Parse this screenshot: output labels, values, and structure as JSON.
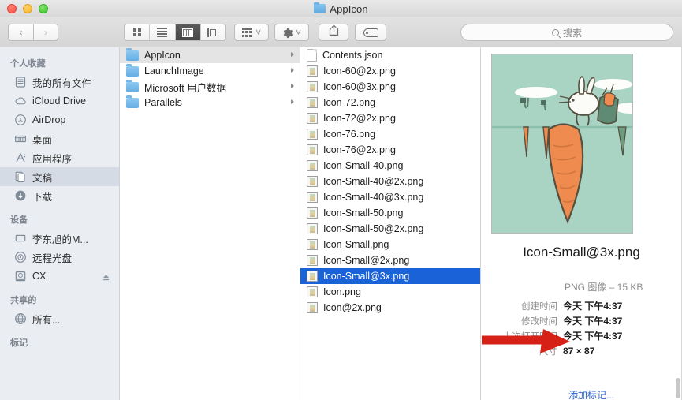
{
  "window": {
    "title": "AppIcon",
    "title_icon": "folder-icon",
    "traffic_lights": [
      "close-button",
      "minimize-button",
      "maximize-button"
    ]
  },
  "toolbar": {
    "back_label": "‹",
    "forward_label": "›",
    "view_modes": [
      {
        "name": "icon-view",
        "label": "icon-grid-icon",
        "active": false
      },
      {
        "name": "list-view",
        "label": "list-icon",
        "active": false
      },
      {
        "name": "column-view",
        "label": "column-icon",
        "active": true
      },
      {
        "name": "coverflow-view",
        "label": "coverflow-icon",
        "active": false
      }
    ],
    "arrange_label": "arrange-icon",
    "action_label": "gear-icon",
    "share_label": "share-icon",
    "tag_label": "tag-icon",
    "chevron": "˅"
  },
  "search": {
    "placeholder": "搜索",
    "value": "",
    "icon": "search-icon"
  },
  "sidebar": {
    "sections": [
      {
        "header": "个人收藏",
        "items": [
          {
            "label": "我的所有文件",
            "icon": "all-my-files-icon",
            "selected": false
          },
          {
            "label": "iCloud Drive",
            "icon": "icloud-icon",
            "selected": false
          },
          {
            "label": "AirDrop",
            "icon": "airdrop-icon",
            "selected": false
          },
          {
            "label": "桌面",
            "icon": "desktop-icon",
            "selected": false
          },
          {
            "label": "应用程序",
            "icon": "applications-icon",
            "selected": false
          },
          {
            "label": "文稿",
            "icon": "documents-icon",
            "selected": true
          },
          {
            "label": "下载",
            "icon": "downloads-icon",
            "selected": false
          }
        ]
      },
      {
        "header": "设备",
        "items": [
          {
            "label": "李东旭的M...",
            "icon": "laptop-icon",
            "selected": false
          },
          {
            "label": "远程光盘",
            "icon": "remote-disc-icon",
            "selected": false
          },
          {
            "label": "CX",
            "icon": "drive-icon",
            "selected": false,
            "eject": true
          }
        ]
      },
      {
        "header": "共享的",
        "items": [
          {
            "label": "所有...",
            "icon": "network-icon",
            "selected": false
          }
        ]
      },
      {
        "header": "标记",
        "items": []
      }
    ]
  },
  "columns": {
    "column1": {
      "items": [
        {
          "name": "AppIcon",
          "type": "folder",
          "selected": true,
          "has_children": true
        },
        {
          "name": "LaunchImage",
          "type": "folder",
          "selected": false,
          "has_children": true
        },
        {
          "name": "Microsoft 用户数据",
          "type": "folder",
          "selected": false,
          "has_children": true
        },
        {
          "name": "Parallels",
          "type": "folder",
          "selected": false,
          "has_children": true
        }
      ]
    },
    "column2": {
      "items": [
        {
          "name": "Contents.json",
          "type": "json",
          "selected": false
        },
        {
          "name": "Icon-60@2x.png",
          "type": "png",
          "selected": false
        },
        {
          "name": "Icon-60@3x.png",
          "type": "png",
          "selected": false
        },
        {
          "name": "Icon-72.png",
          "type": "png",
          "selected": false
        },
        {
          "name": "Icon-72@2x.png",
          "type": "png",
          "selected": false
        },
        {
          "name": "Icon-76.png",
          "type": "png",
          "selected": false
        },
        {
          "name": "Icon-76@2x.png",
          "type": "png",
          "selected": false
        },
        {
          "name": "Icon-Small-40.png",
          "type": "png",
          "selected": false
        },
        {
          "name": "Icon-Small-40@2x.png",
          "type": "png",
          "selected": false
        },
        {
          "name": "Icon-Small-40@3x.png",
          "type": "png",
          "selected": false
        },
        {
          "name": "Icon-Small-50.png",
          "type": "png",
          "selected": false
        },
        {
          "name": "Icon-Small-50@2x.png",
          "type": "png",
          "selected": false
        },
        {
          "name": "Icon-Small.png",
          "type": "png",
          "selected": false
        },
        {
          "name": "Icon-Small@2x.png",
          "type": "png",
          "selected": false
        },
        {
          "name": "Icon-Small@3x.png",
          "type": "png",
          "selected": true
        },
        {
          "name": "Icon.png",
          "type": "png",
          "selected": false
        },
        {
          "name": "Icon@2x.png",
          "type": "png",
          "selected": false
        }
      ]
    }
  },
  "preview": {
    "thumbnail_alt": "carrot-rabbit-illustration",
    "filename": "Icon-Small@3x.png",
    "kind_and_size": "PNG 图像 – 15 KB",
    "metadata": [
      {
        "key": "创建时间",
        "value": "今天 下午4:37"
      },
      {
        "key": "修改时间",
        "value": "今天 下午4:37"
      },
      {
        "key": "上次打开时间",
        "value": "今天 下午4:37"
      },
      {
        "key": "尺寸",
        "value": "87 × 87"
      }
    ],
    "add_tags_label": "添加标记..."
  },
  "annotation": {
    "type": "red-arrow",
    "points_to": "尺寸 87 × 87",
    "color": "#d62117"
  }
}
